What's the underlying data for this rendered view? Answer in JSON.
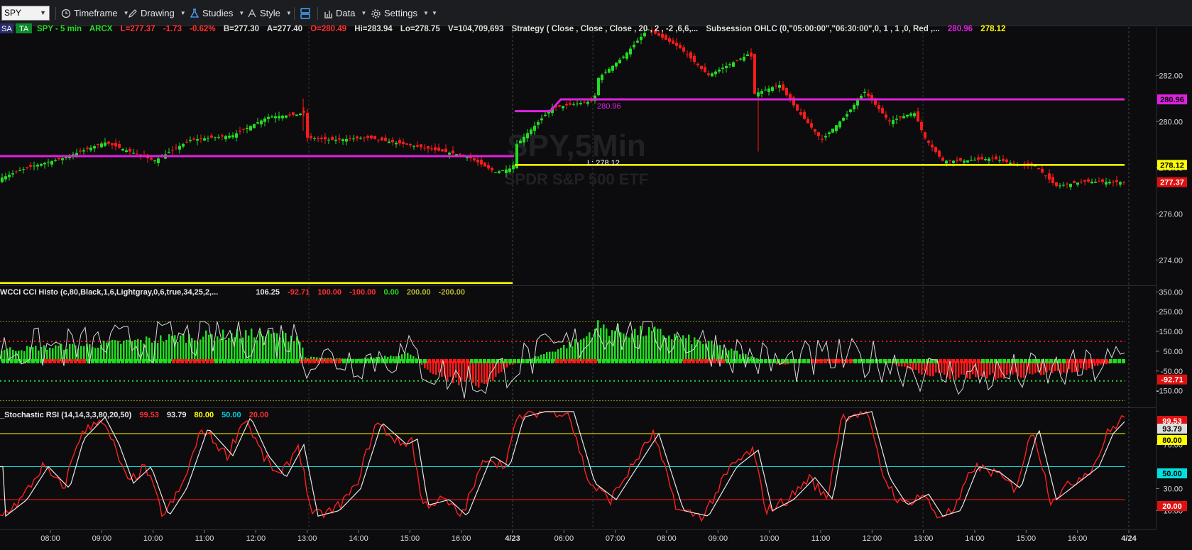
{
  "toolbar": {
    "symbol": "SPY",
    "timeframe": "Timeframe",
    "drawing": "Drawing",
    "studies": "Studies",
    "style": "Style",
    "data": "Data",
    "settings": "Settings"
  },
  "legend": {
    "sa": "SA",
    "ta": "TA",
    "symbol": "SPY - 5 min",
    "exchange": "ARCX",
    "last": "L=277.37",
    "change": "-1.73",
    "change_pct": "-0.62%",
    "bid": "B=277.30",
    "ask": "A=277.40",
    "open": "O=280.49",
    "high": "Hi=283.94",
    "low": "Lo=278.75",
    "volume": "V=104,709,693",
    "strategy": "Strategy ( Close , Close , Close , 20 , 2 , -2 ,6,6,...",
    "subsession": "Subsession OHLC (0,\"05:00:00\",\"06:30:00\",0, 1 , 1 ,0, Red ,...",
    "val1": "280.96",
    "val2": "278.12"
  },
  "watermark": {
    "title": "SPY,5Min",
    "subtitle": "SPDR S&P 500 ETF"
  },
  "price_pane": {
    "line_label_magenta": "280.96",
    "line_label_yellow": "L: 278.12",
    "axis_ticks": [
      "282.00",
      "280.00",
      "278.00",
      "276.00",
      "274.00"
    ],
    "axis_tick_values": [
      282,
      280,
      278,
      276,
      274
    ],
    "price_min": 272.9,
    "price_max": 284.1,
    "badges": [
      {
        "text": "280.96",
        "value": 280.96,
        "bg": "#e020e0",
        "fg": "#000000"
      },
      {
        "text": "278.12",
        "value": 278.12,
        "bg": "#ffff00",
        "fg": "#000000"
      },
      {
        "text": "277.37",
        "value": 277.37,
        "bg": "#e01010",
        "fg": "#ffffff"
      }
    ]
  },
  "cci_pane": {
    "label": "WCCI CCI Histo (c,80,Black,1,6,Lightgray,0,6,true,34,25,2,...",
    "v1": "106.25",
    "v2": "-92.71",
    "v3": "100.00",
    "v4": "-100.00",
    "v5": "0.00",
    "v6": "200.00",
    "v7": "-200.00",
    "axis_ticks": [
      "350.00",
      "250.00",
      "150.00",
      "50.00",
      "-50.00",
      "-150.00"
    ],
    "axis_tick_values": [
      350,
      250,
      150,
      50,
      -50,
      -150
    ],
    "min": -230,
    "max": 380,
    "badge": {
      "text": "-92.71",
      "value": -92.71
    }
  },
  "stoch_pane": {
    "label": "_Stochastic RSI (14,14,3,3,80,20,50)",
    "v1": "99.53",
    "v2": "93.79",
    "v3": "80.00",
    "v4": "50.00",
    "v5": "20.00",
    "axis_ticks": [
      "70.00",
      "30.00",
      "10.00"
    ],
    "axis_tick_values": [
      70,
      30,
      10
    ],
    "badges": [
      {
        "text": "99.53",
        "value": 99.53,
        "bg": "#e01010",
        "fg": "#ffffff"
      },
      {
        "text": "93.79",
        "value": 93.79,
        "bg": "#dddddd",
        "fg": "#000000"
      },
      {
        "text": "80.00",
        "value": 80,
        "bg": "#ffff00",
        "fg": "#000000"
      },
      {
        "text": "50.00",
        "value": 50,
        "bg": "#00e0e0",
        "fg": "#000000"
      },
      {
        "text": "20.00",
        "value": 20,
        "bg": "#e01010",
        "fg": "#ffffff"
      }
    ]
  },
  "time_axis": {
    "labels": [
      "08:00",
      "09:00",
      "10:00",
      "11:00",
      "12:00",
      "13:00",
      "14:00",
      "15:00",
      "16:00",
      "4/23",
      "06:00",
      "07:00",
      "08:00",
      "09:00",
      "10:00",
      "11:00",
      "12:00",
      "13:00",
      "14:00",
      "15:00",
      "16:00",
      "4/24"
    ],
    "bold": [
      false,
      false,
      false,
      false,
      false,
      false,
      false,
      false,
      false,
      true,
      false,
      false,
      false,
      false,
      false,
      false,
      false,
      false,
      false,
      false,
      false,
      true
    ]
  },
  "colors": {
    "up": "#22dd22",
    "down": "#ff1a1a",
    "magenta": "#e020e0",
    "yellow": "#ffff00",
    "cyan": "#00e0e0"
  }
}
